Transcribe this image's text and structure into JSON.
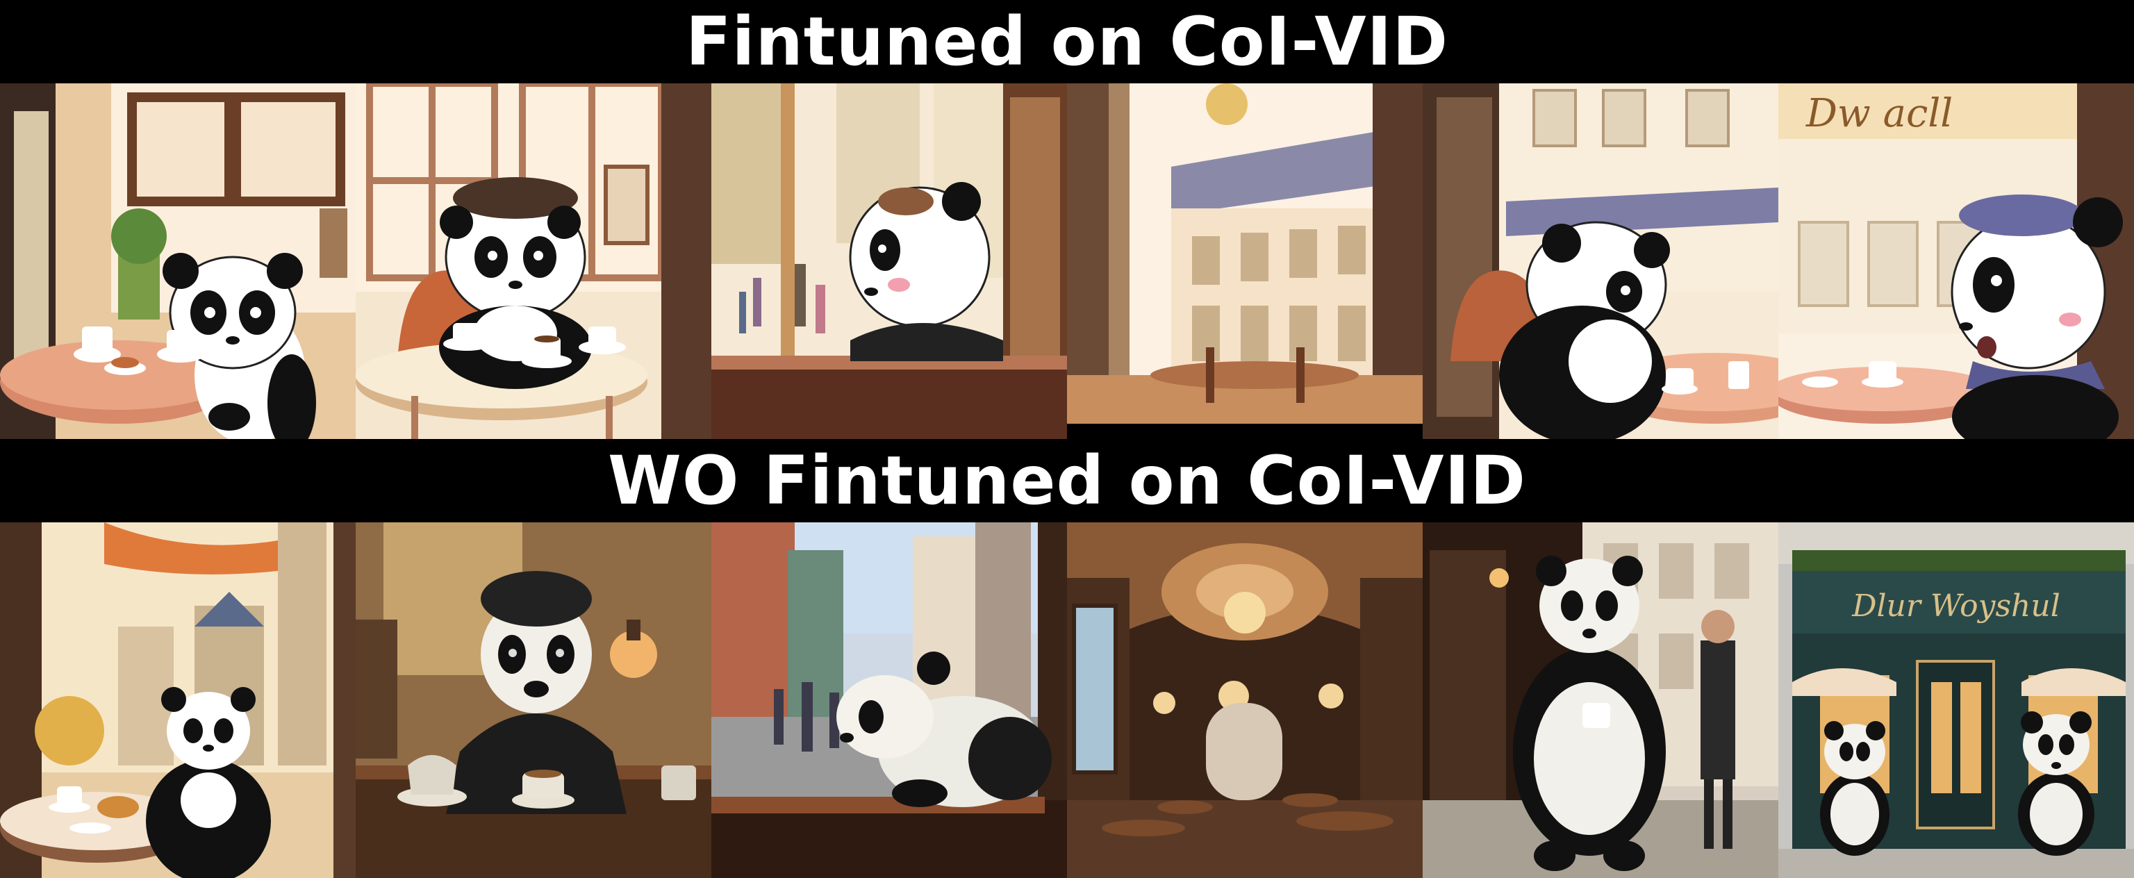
{
  "sections": [
    {
      "title": "Fintuned on CoI-VID",
      "style": "anime-illustration",
      "frames": [
        {
          "scene": "panda-cafe-window-table"
        },
        {
          "scene": "panda-cafe-sipping-coffee"
        },
        {
          "scene": "panda-gazing-street-window"
        },
        {
          "scene": "parisian-building-interior"
        },
        {
          "scene": "panda-cafe-street-view"
        },
        {
          "scene": "panda-cafe-sign-surprised"
        }
      ]
    },
    {
      "title": "WO Fintuned on CoI-VID",
      "style": "realistic-render",
      "frames": [
        {
          "scene": "panda-cafe-window-pastry"
        },
        {
          "scene": "panda-in-cap-with-coffee"
        },
        {
          "scene": "panda-leaning-window-street"
        },
        {
          "scene": "ornate-cafe-hall-chandeliers"
        },
        {
          "scene": "panda-holding-cup-street"
        },
        {
          "scene": "cafe-storefront-two-pandas"
        }
      ]
    }
  ],
  "storefront_sign": "Dlur Woyshul",
  "window_sign": "Dw acll"
}
